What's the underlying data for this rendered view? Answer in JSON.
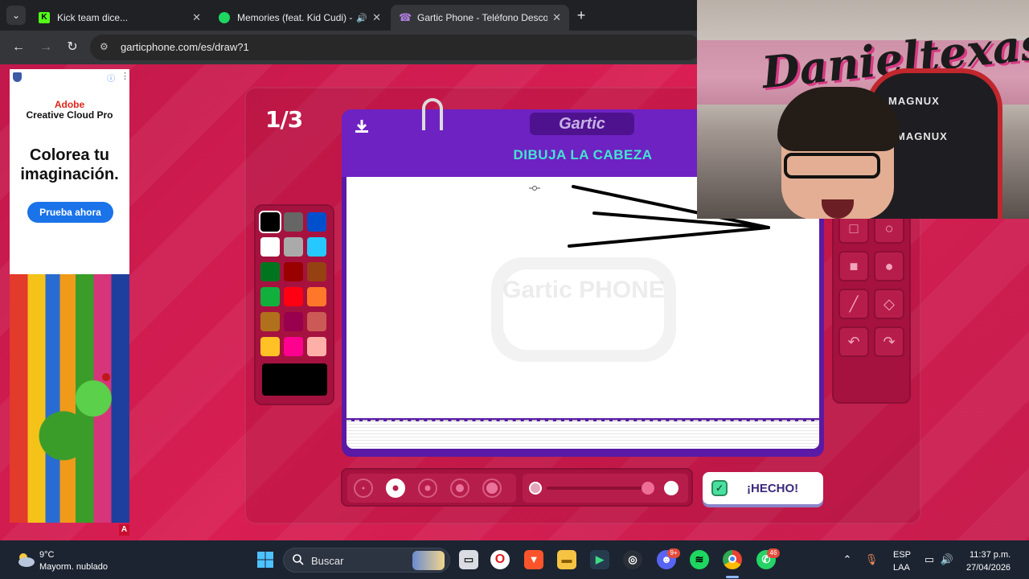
{
  "browser": {
    "tabs": [
      {
        "title": "Kick team dice...",
        "active": false,
        "favicon_color": "#53fc18",
        "icon": "kick-icon"
      },
      {
        "title": "Memories (feat. Kid Cudi) -",
        "active": false,
        "favicon_color": "#1ed760",
        "icon": "spotify-icon",
        "audio": true
      },
      {
        "title": "Gartic Phone - Teléfono Descon",
        "active": true,
        "favicon_color": "#b07fe0",
        "icon": "gartic-icon"
      }
    ],
    "new_tab": "+",
    "tab_menu": "⌄",
    "url": "garticphone.com/es/draw?1"
  },
  "ad": {
    "brand_line1": "Adobe",
    "brand_line2": "Creative Cloud Pro",
    "headline_line1": "Colorea tu",
    "headline_line2": "imaginación.",
    "cta": "Prueba ahora",
    "badge": "A"
  },
  "game": {
    "round": "1/3",
    "logo": "Gartic",
    "prompt": "DIBUJA LA CABEZA",
    "watermark": "Gartic PHONE",
    "colors": [
      "#000000",
      "#666666",
      "#0050cd",
      "#ffffff",
      "#aaaaaa",
      "#26c9ff",
      "#017420",
      "#990000",
      "#964112",
      "#11b03c",
      "#ff0013",
      "#ff7829",
      "#b0701c",
      "#99004e",
      "#cb5a57",
      "#ffc126",
      "#ff008f",
      "#feafa8"
    ],
    "selected_color_index": 0,
    "current_color": "#000000",
    "tools": [
      "pencil-icon",
      "eraser-icon",
      "rect-outline-icon",
      "ellipse-outline-icon",
      "rect-fill-icon",
      "ellipse-fill-icon",
      "line-icon",
      "bucket-icon",
      "undo-icon",
      "redo-icon"
    ],
    "active_tool_index": 0,
    "brush_sizes": 5,
    "selected_brush_index": 1,
    "opacity": 0.85,
    "done_label": "¡HECHO!"
  },
  "webcam": {
    "graffiti": "Danieltexas",
    "chair_brand": "MAGNUX"
  },
  "taskbar": {
    "weather_temp": "9°C",
    "weather_desc": "Mayorm. nublado",
    "search_placeholder": "Buscar",
    "discord_badge": "9+",
    "whatsapp_badge": "46",
    "lang": "ESP",
    "layout": "LAA",
    "time": "11:37 p.m.",
    "date": "27/04/2026"
  }
}
